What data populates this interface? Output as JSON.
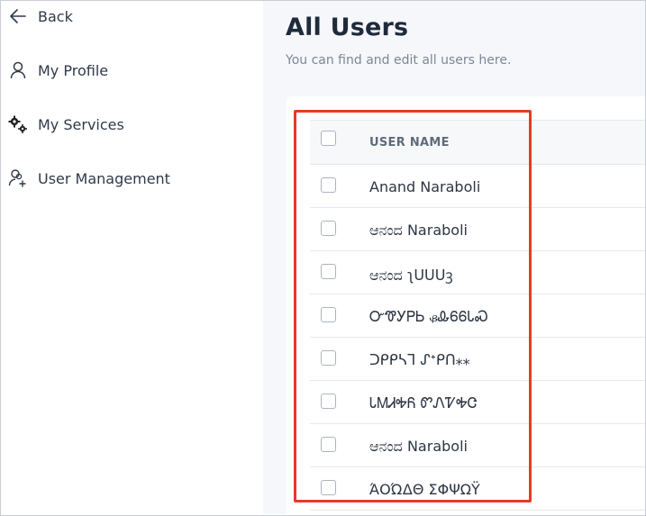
{
  "sidebar": {
    "items": [
      {
        "label": "Back",
        "icon": "arrow-left-icon"
      },
      {
        "label": "My Profile",
        "icon": "user-icon"
      },
      {
        "label": "My Services",
        "icon": "gears-icon"
      },
      {
        "label": "User Management",
        "icon": "user-management-icon"
      }
    ]
  },
  "main": {
    "title": "All Users",
    "subtitle": "You can find and edit all users here.",
    "table": {
      "header": "USER NAME",
      "rows": [
        "Anand Naraboli",
        "ಆನಂದ Naraboli",
        "ಆನಂದ ʅᑌᑌᑌꝫ",
        "ᏅᏡᎩᏢᏏ ᏸᎲᏮᏮᏓᏍ",
        "ᑐᑭᑭᓴᒣ ᔑᕀᑭᑎ⁎⁎",
        "ᏓᎷᏗᎭᏲ ᏛᏁᏤᎭᏣ",
        "ಆನಂದ Naraboli",
        "ΆΟΏΔΘ ΣΦΨΩΫ"
      ]
    }
  },
  "colors": {
    "highlight": "#e53b25",
    "main_bg": "#f5f7fb"
  }
}
